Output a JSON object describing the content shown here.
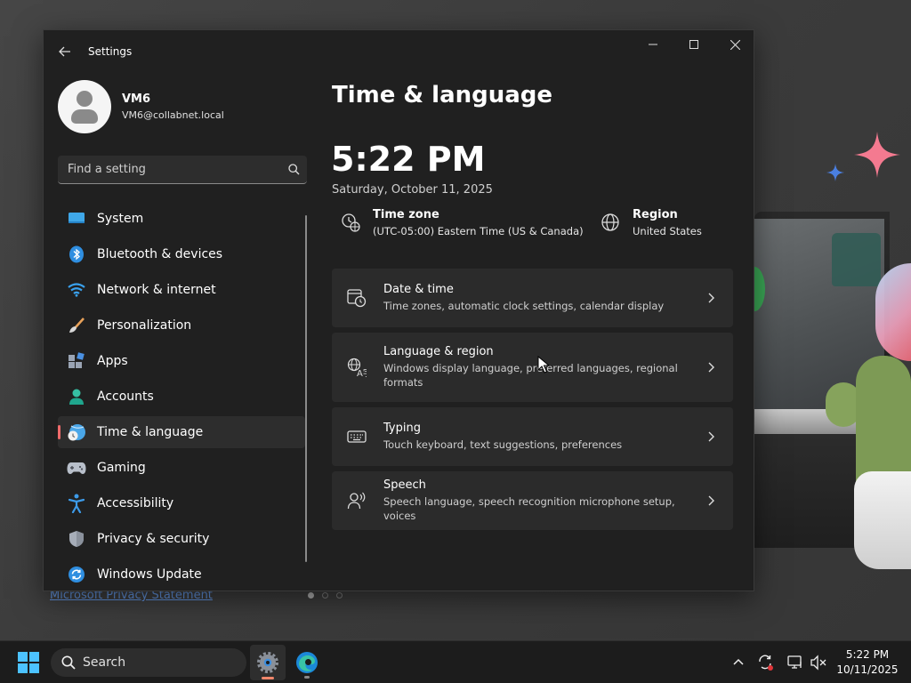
{
  "window": {
    "app_title": "Settings"
  },
  "profile": {
    "name": "VM6",
    "email": "VM6@collabnet.local"
  },
  "search": {
    "placeholder": "Find a setting"
  },
  "sidebar": {
    "items": [
      {
        "label": "System",
        "icon": "system-icon"
      },
      {
        "label": "Bluetooth & devices",
        "icon": "bluetooth-icon"
      },
      {
        "label": "Network & internet",
        "icon": "wifi-icon"
      },
      {
        "label": "Personalization",
        "icon": "brush-icon"
      },
      {
        "label": "Apps",
        "icon": "apps-icon"
      },
      {
        "label": "Accounts",
        "icon": "accounts-icon"
      },
      {
        "label": "Time & language",
        "icon": "time-language-icon",
        "selected": true
      },
      {
        "label": "Gaming",
        "icon": "gamepad-icon"
      },
      {
        "label": "Accessibility",
        "icon": "accessibility-icon"
      },
      {
        "label": "Privacy & security",
        "icon": "shield-icon"
      },
      {
        "label": "Windows Update",
        "icon": "update-icon"
      }
    ]
  },
  "main": {
    "title": "Time & language",
    "time": "5:22 PM",
    "date": "Saturday, October 11, 2025",
    "timezone": {
      "title": "Time zone",
      "value": "(UTC-05:00) Eastern Time (US & Canada)"
    },
    "region": {
      "title": "Region",
      "value": "United States"
    },
    "cards": [
      {
        "title": "Date & time",
        "desc": "Time zones, automatic clock settings, calendar display"
      },
      {
        "title": "Language & region",
        "desc": "Windows display language, preferred languages, regional formats"
      },
      {
        "title": "Typing",
        "desc": "Touch keyboard, text suggestions, preferences"
      },
      {
        "title": "Speech",
        "desc": "Speech language, speech recognition microphone setup, voices"
      }
    ]
  },
  "desktop": {
    "privacy_link": "Microsoft Privacy Statement"
  },
  "taskbar": {
    "search_label": "Search",
    "clock_time": "5:22 PM",
    "clock_date": "10/11/2025"
  },
  "colors": {
    "accent": "#f06b6b",
    "window_bg": "#202020",
    "card_bg": "#2b2b2b",
    "taskbar_bg": "#1c1c1c"
  }
}
